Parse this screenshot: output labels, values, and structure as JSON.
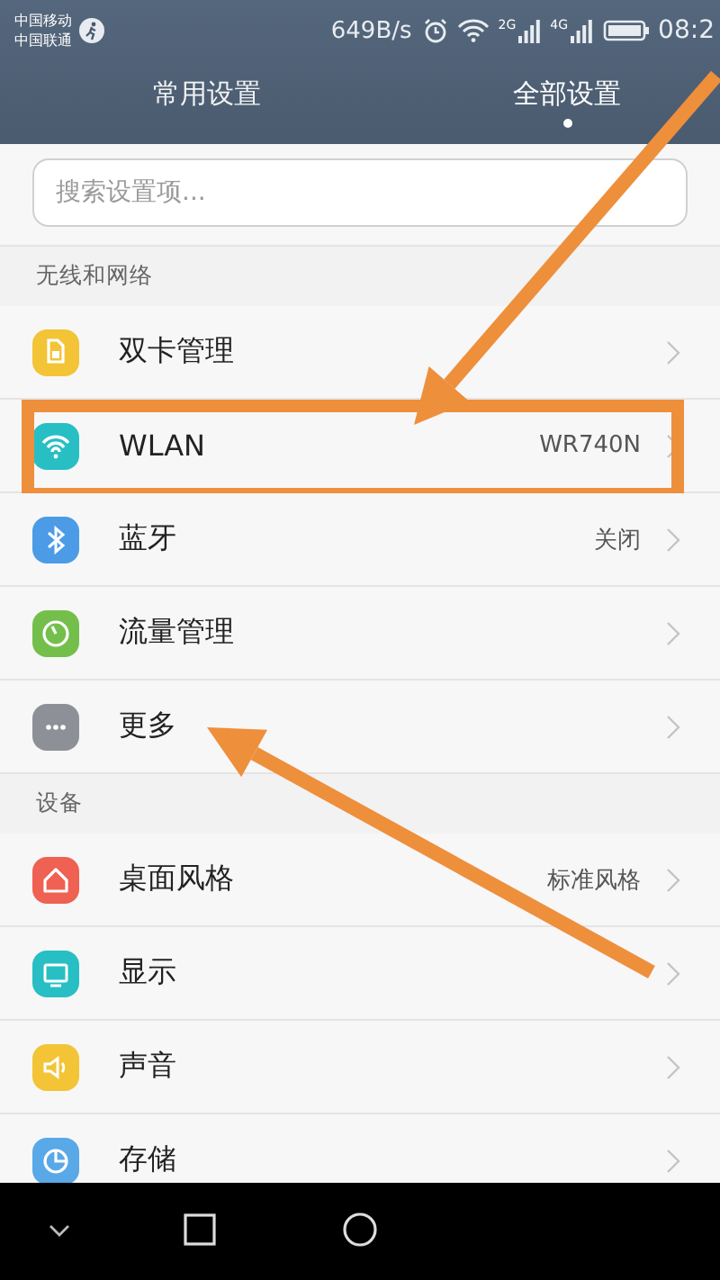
{
  "status_bar": {
    "carriers": [
      "中国移动",
      "中国联通"
    ],
    "speed": "649B/s",
    "network_labels": [
      "2G",
      "4G"
    ],
    "time": "08:2"
  },
  "tabs": [
    {
      "label": "常用设置",
      "selected": false
    },
    {
      "label": "全部设置",
      "selected": true
    }
  ],
  "search": {
    "placeholder": "搜索设置项..."
  },
  "sections": [
    {
      "title": "无线和网络",
      "items": [
        {
          "label": "双卡管理",
          "color": "#f2c436",
          "highlighted": false,
          "arrow": false
        },
        {
          "label": "WLAN",
          "value": "WR740N",
          "color": "#27bfc3",
          "highlighted": true,
          "arrow": true
        },
        {
          "label": "蓝牙",
          "value": "关闭",
          "color": "#4b9be6",
          "highlighted": false,
          "arrow": false
        },
        {
          "label": "流量管理",
          "color": "#74bf4c",
          "highlighted": false,
          "arrow": false
        },
        {
          "label": "更多",
          "color": "#8d9096",
          "highlighted": false,
          "arrow": true
        }
      ]
    },
    {
      "title": "设备",
      "items": [
        {
          "label": "桌面风格",
          "value": "标准风格",
          "color": "#ef6152",
          "highlighted": false,
          "arrow": false
        },
        {
          "label": "显示",
          "color": "#27bfc3",
          "highlighted": false,
          "arrow": false
        },
        {
          "label": "声音",
          "color": "#f2c436",
          "highlighted": false,
          "arrow": false
        },
        {
          "label": "存储",
          "color": "#59a8e8",
          "highlighted": false,
          "arrow": false
        }
      ]
    }
  ]
}
